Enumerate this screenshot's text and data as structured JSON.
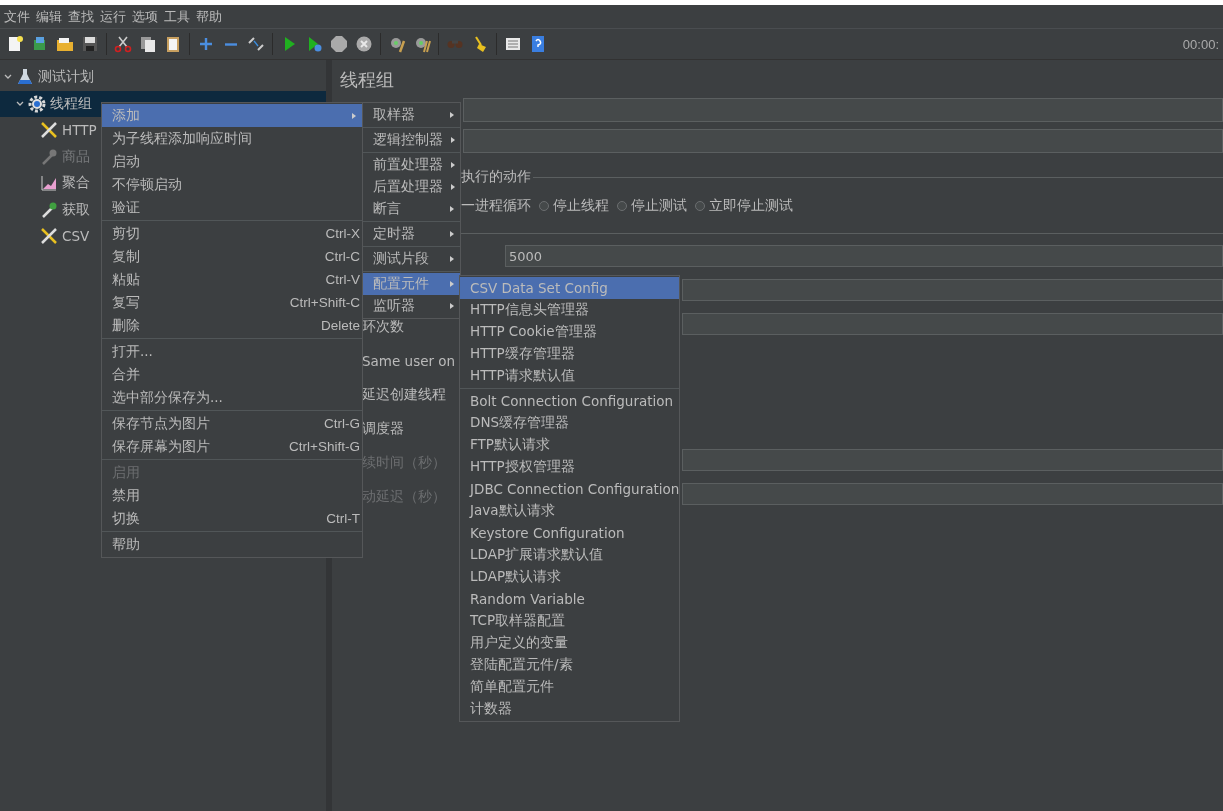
{
  "menu_bar": [
    "文件",
    "编辑",
    "查找",
    "运行",
    "选项",
    "工具",
    "帮助"
  ],
  "toolbar": {
    "timer": "00:00:"
  },
  "tree": [
    {
      "label": "测试计划",
      "kind": "plan",
      "selected": false,
      "expanded": true,
      "disabled": false,
      "children": [
        {
          "label": "线程组",
          "kind": "thread_group",
          "selected": true,
          "expanded": true,
          "disabled": false,
          "children": [
            {
              "label": "HTTP",
              "kind": "tool",
              "selected": false,
              "disabled": false
            },
            {
              "label": "商品",
              "kind": "dropper",
              "selected": false,
              "disabled": true
            },
            {
              "label": "聚合",
              "kind": "chart",
              "selected": false,
              "disabled": false
            },
            {
              "label": "获取",
              "kind": "dropper",
              "selected": false,
              "disabled": false
            },
            {
              "label": "CSV",
              "kind": "tool",
              "selected": false,
              "disabled": false
            }
          ]
        }
      ]
    }
  ],
  "panel": {
    "title": "线程组",
    "action_group": {
      "legend": "执行的动作",
      "leading_text": "一进程循环",
      "radios": [
        {
          "label": "停止线程",
          "selected": false
        },
        {
          "label": "停止测试",
          "selected": false
        },
        {
          "label": "立即停止测试",
          "selected": false
        }
      ]
    },
    "rows": [
      {
        "kind": "field",
        "value": "5000"
      },
      {
        "kind": "field"
      },
      {
        "kind": "label_field",
        "label": "环次数",
        "disabled": false
      },
      {
        "kind": "label",
        "label": "Same user on",
        "disabled": false
      },
      {
        "kind": "label",
        "label": "延迟创建线程",
        "disabled": false
      },
      {
        "kind": "label",
        "label": "调度器",
        "disabled": false
      },
      {
        "kind": "label_field",
        "label": "续时间（秒）",
        "disabled": true
      },
      {
        "kind": "label_field",
        "label": "动延迟（秒）",
        "disabled": true
      }
    ]
  },
  "context_menu": {
    "groups": [
      [
        {
          "label": "添加",
          "selected": true,
          "disabled": false,
          "submenu": true
        },
        {
          "label": "为子线程添加响应时间",
          "selected": false,
          "disabled": false,
          "submenu": false
        },
        {
          "label": "启动",
          "selected": false,
          "disabled": false,
          "submenu": false
        },
        {
          "label": "不停顿启动",
          "selected": false,
          "disabled": false,
          "submenu": false
        },
        {
          "label": "验证",
          "selected": false,
          "disabled": false,
          "submenu": false
        }
      ],
      [
        {
          "label": "剪切",
          "shortcut": "Ctrl-X",
          "selected": false,
          "disabled": false,
          "submenu": false
        },
        {
          "label": "复制",
          "shortcut": "Ctrl-C",
          "selected": false,
          "disabled": false,
          "submenu": false
        },
        {
          "label": "粘贴",
          "shortcut": "Ctrl-V",
          "selected": false,
          "disabled": false,
          "submenu": false
        },
        {
          "label": "复写",
          "shortcut": "Ctrl+Shift-C",
          "selected": false,
          "disabled": false,
          "submenu": false
        },
        {
          "label": "删除",
          "shortcut": "Delete",
          "selected": false,
          "disabled": false,
          "submenu": false
        }
      ],
      [
        {
          "label": "打开...",
          "selected": false,
          "disabled": false,
          "submenu": false
        },
        {
          "label": "合并",
          "selected": false,
          "disabled": false,
          "submenu": false
        },
        {
          "label": "选中部分保存为...",
          "selected": false,
          "disabled": false,
          "submenu": false
        }
      ],
      [
        {
          "label": "保存节点为图片",
          "shortcut": "Ctrl-G",
          "selected": false,
          "disabled": false,
          "submenu": false
        },
        {
          "label": "保存屏幕为图片",
          "shortcut": "Ctrl+Shift-G",
          "selected": false,
          "disabled": false,
          "submenu": false
        }
      ],
      [
        {
          "label": "启用",
          "selected": false,
          "disabled": true,
          "submenu": false
        },
        {
          "label": "禁用",
          "selected": false,
          "disabled": false,
          "submenu": false
        },
        {
          "label": "切换",
          "shortcut": "Ctrl-T",
          "selected": false,
          "disabled": false,
          "submenu": false
        }
      ],
      [
        {
          "label": "帮助",
          "selected": false,
          "disabled": false,
          "submenu": false
        }
      ]
    ]
  },
  "add_submenu": {
    "groups": [
      [
        {
          "label": "取样器",
          "selected": false,
          "submenu": true
        }
      ],
      [
        {
          "label": "逻辑控制器",
          "selected": false,
          "submenu": true
        }
      ],
      [
        {
          "label": "前置处理器",
          "selected": false,
          "submenu": true
        },
        {
          "label": "后置处理器",
          "selected": false,
          "submenu": true
        },
        {
          "label": "断言",
          "selected": false,
          "submenu": true
        }
      ],
      [
        {
          "label": "定时器",
          "selected": false,
          "submenu": true
        }
      ],
      [
        {
          "label": "测试片段",
          "selected": false,
          "submenu": true
        }
      ],
      [
        {
          "label": "配置元件",
          "selected": true,
          "submenu": true
        },
        {
          "label": "监听器",
          "selected": false,
          "submenu": true
        }
      ]
    ]
  },
  "config_submenu": {
    "groups": [
      [
        {
          "label": "CSV Data Set Config",
          "selected": true
        },
        {
          "label": "HTTP信息头管理器",
          "selected": false
        },
        {
          "label": "HTTP Cookie管理器",
          "selected": false
        },
        {
          "label": "HTTP缓存管理器",
          "selected": false
        },
        {
          "label": "HTTP请求默认值",
          "selected": false
        }
      ],
      [
        {
          "label": "Bolt Connection Configuration",
          "selected": false
        },
        {
          "label": "DNS缓存管理器",
          "selected": false
        },
        {
          "label": "FTP默认请求",
          "selected": false
        },
        {
          "label": "HTTP授权管理器",
          "selected": false
        },
        {
          "label": "JDBC Connection Configuration",
          "selected": false
        },
        {
          "label": "Java默认请求",
          "selected": false
        },
        {
          "label": "Keystore Configuration",
          "selected": false
        },
        {
          "label": "LDAP扩展请求默认值",
          "selected": false
        },
        {
          "label": "LDAP默认请求",
          "selected": false
        },
        {
          "label": "Random Variable",
          "selected": false
        },
        {
          "label": "TCP取样器配置",
          "selected": false
        },
        {
          "label": "用户定义的变量",
          "selected": false
        },
        {
          "label": "登陆配置元件/素",
          "selected": false
        },
        {
          "label": "简单配置元件",
          "selected": false
        },
        {
          "label": "计数器",
          "selected": false
        }
      ]
    ]
  }
}
